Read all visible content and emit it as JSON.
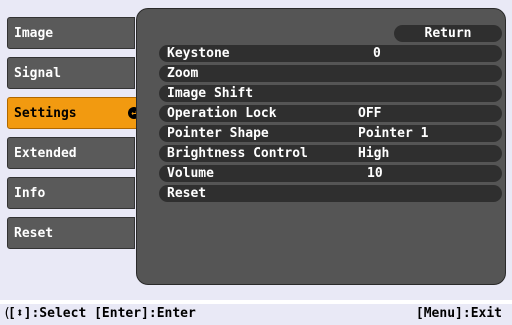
{
  "tabs": [
    {
      "label": "Image",
      "active": false
    },
    {
      "label": "Signal",
      "active": false
    },
    {
      "label": "Settings",
      "active": true
    },
    {
      "label": "Extended",
      "active": false
    },
    {
      "label": "Info",
      "active": false
    },
    {
      "label": "Reset",
      "active": false
    }
  ],
  "panel": {
    "return_label": "Return",
    "items": [
      {
        "label": "Keystone",
        "value": "0"
      },
      {
        "label": "Zoom",
        "value": ""
      },
      {
        "label": "Image Shift",
        "value": ""
      },
      {
        "label": "Operation Lock",
        "value": "OFF"
      },
      {
        "label": "Pointer Shape",
        "value": "Pointer 1"
      },
      {
        "label": "Brightness Control",
        "value": "High"
      },
      {
        "label": "Volume",
        "value": "10"
      },
      {
        "label": "Reset",
        "value": ""
      }
    ]
  },
  "footer": {
    "left_text": "[⬍]:Select [Enter]:Enter",
    "right_text": "[Menu]:Exit"
  },
  "colors": {
    "accent": "#f29a10",
    "tab_bg": "#5a5a5a",
    "panel_bg": "#555555",
    "row_bg": "#2f2f2f"
  },
  "icons": {
    "active_tab": "enter-icon"
  }
}
